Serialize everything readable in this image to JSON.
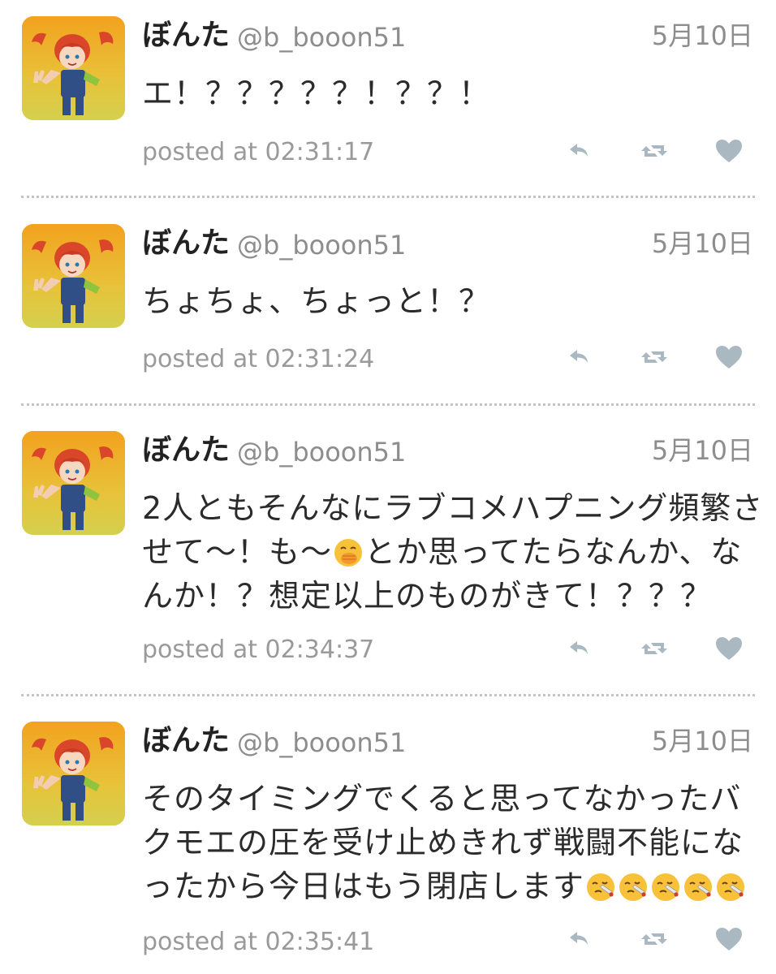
{
  "tweets": [
    {
      "avatar_icon": "avatar-girl-red-twintails",
      "display_name": "ぼんた",
      "handle": "@b_booon51",
      "date": "5月10日",
      "text": "エ！？？？？？！？？！",
      "posted": "posted at 02:31:17"
    },
    {
      "avatar_icon": "avatar-girl-red-twintails",
      "display_name": "ぼんた",
      "handle": "@b_booon51",
      "date": "5月10日",
      "text": "ちょちょ、ちょっと！？",
      "posted": "posted at 02:31:24"
    },
    {
      "avatar_icon": "avatar-girl-red-twintails",
      "display_name": "ぼんた",
      "handle": "@b_booon51",
      "date": "5月10日",
      "text_before_emoji": "2人ともそんなにラブコメハプニング頻繁させて〜！も〜",
      "emoji": "hand-over-mouth-emoji",
      "text_after_emoji": "とか思ってたらなんか、なんか！？想定以上のものがきて！？？？",
      "posted": "posted at 02:34:37"
    },
    {
      "avatar_icon": "avatar-girl-red-twintails",
      "display_name": "ぼんた",
      "handle": "@b_booon51",
      "date": "5月10日",
      "text": "そのタイミングでくると思ってなかったバクモエの圧を受け止めきれず戦闘不能になったから今日はもう閉店します",
      "trailing_emoji": "face-with-thermometer-emoji",
      "trailing_emoji_count": 5,
      "posted": "posted at 02:35:41"
    }
  ],
  "actions": {
    "reply_icon": "reply-icon",
    "retweet_icon": "retweet-icon",
    "like_icon": "heart-icon",
    "icon_color": "#aab8c2"
  }
}
